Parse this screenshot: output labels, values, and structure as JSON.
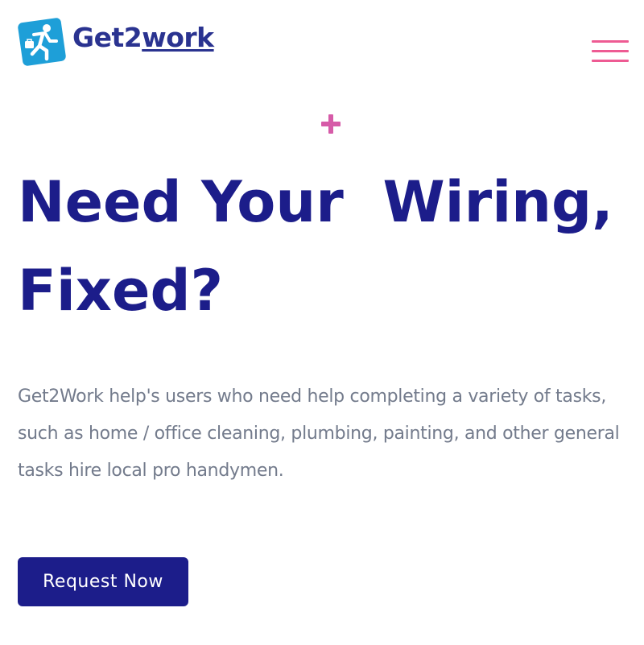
{
  "header": {
    "logo": {
      "text_prefix": "Get2",
      "text_suffix": "work",
      "icon": "running-worker-icon"
    },
    "menu": {
      "icon": "hamburger-menu-icon",
      "color": "#ee5b93"
    }
  },
  "hero": {
    "decoration_icon": "plus-icon",
    "decoration_color": "#d65ba8",
    "headline": "Need Your  Wiring, Fixed?",
    "description": "Get2Work help's users who need help completing a variety of tasks, such as home / office cleaning, plumbing, painting, and other general tasks hire local pro handymen.",
    "cta_label": "Request Now"
  },
  "colors": {
    "primary": "#1c1d8a",
    "accent": "#ee5b93",
    "text_muted": "#737b8c",
    "logo_blue": "#1e9fd8"
  }
}
